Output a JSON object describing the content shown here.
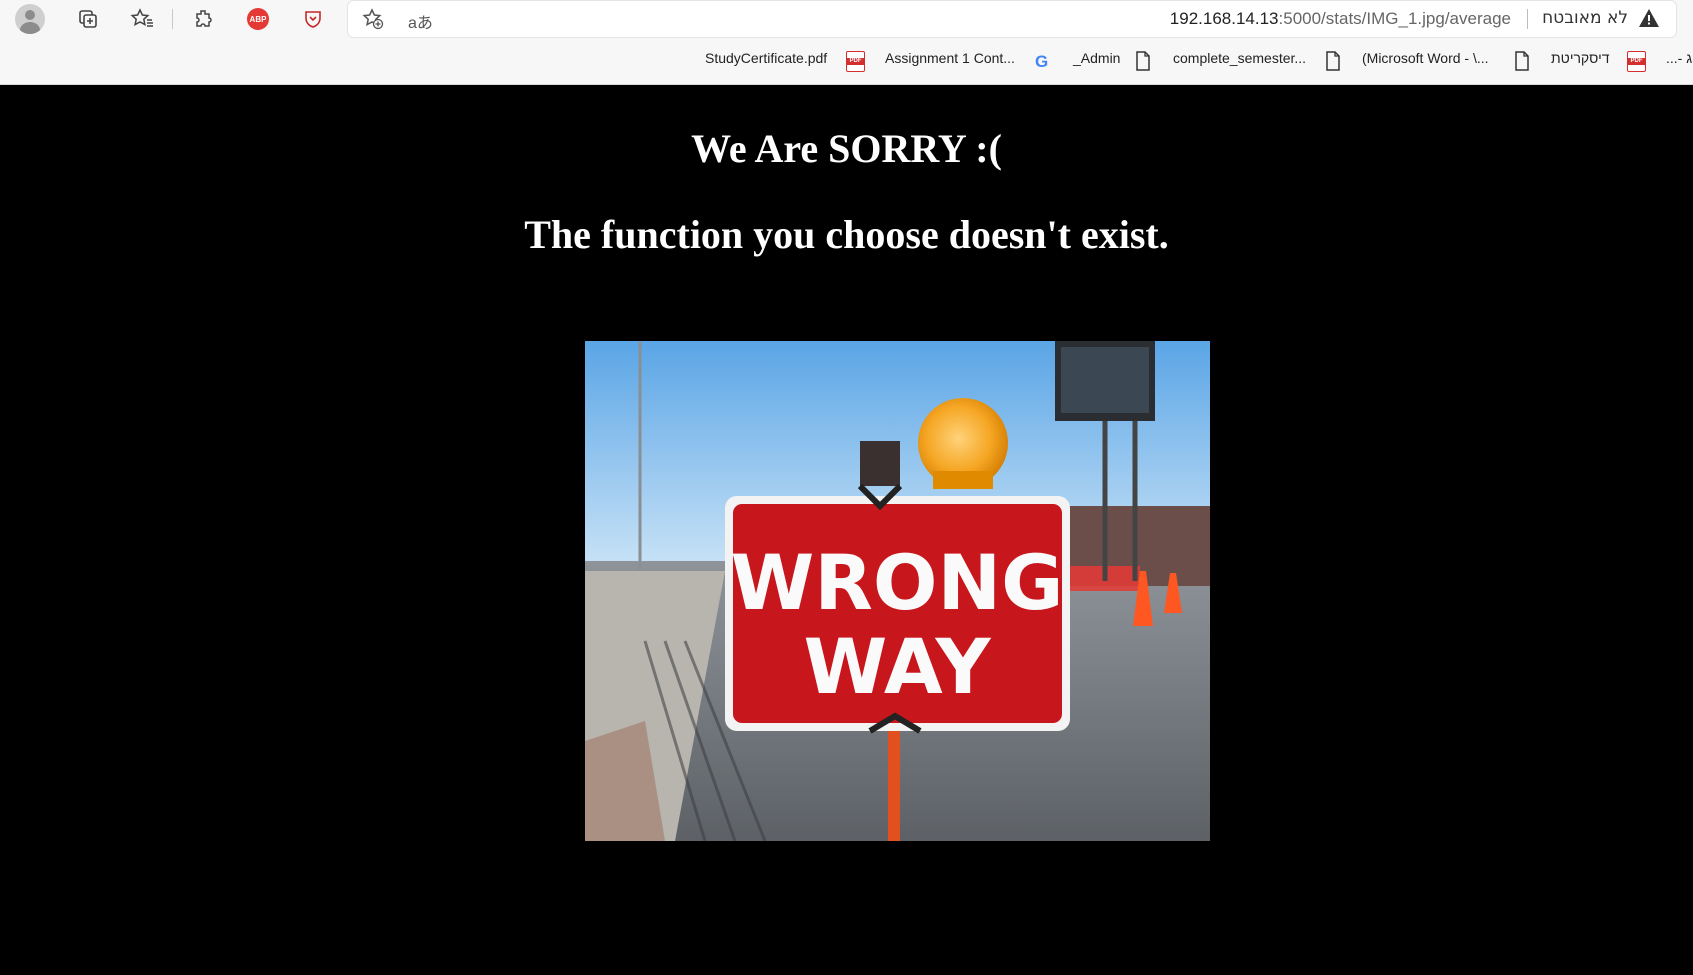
{
  "browser": {
    "url_host": "192.168.14.13",
    "url_path": ":5000/stats/IMG_1.jpg/average",
    "security_label": "לא מאובטח",
    "translate_glyph": "aあ",
    "abp_label": "ABP"
  },
  "bookmarks": [
    {
      "label": "StudyCertificate.pdf",
      "icon": "pdf-icon"
    },
    {
      "label": "Assignment 1 Cont...",
      "icon": "google-icon"
    },
    {
      "label": "_Admin",
      "icon": "file-icon"
    },
    {
      "label": "complete_semester...",
      "icon": "file-icon"
    },
    {
      "label": "(Microsoft Word - \\...",
      "icon": "file-icon"
    },
    {
      "label": "דיסקריטת",
      "icon": "pdf-icon"
    },
    {
      "label": "...- ג",
      "icon": "none"
    }
  ],
  "page": {
    "title": "We Are SORRY :(",
    "message": "The function you choose doesn't exist.",
    "sign_line1": "WRONG",
    "sign_line2": "WAY"
  }
}
